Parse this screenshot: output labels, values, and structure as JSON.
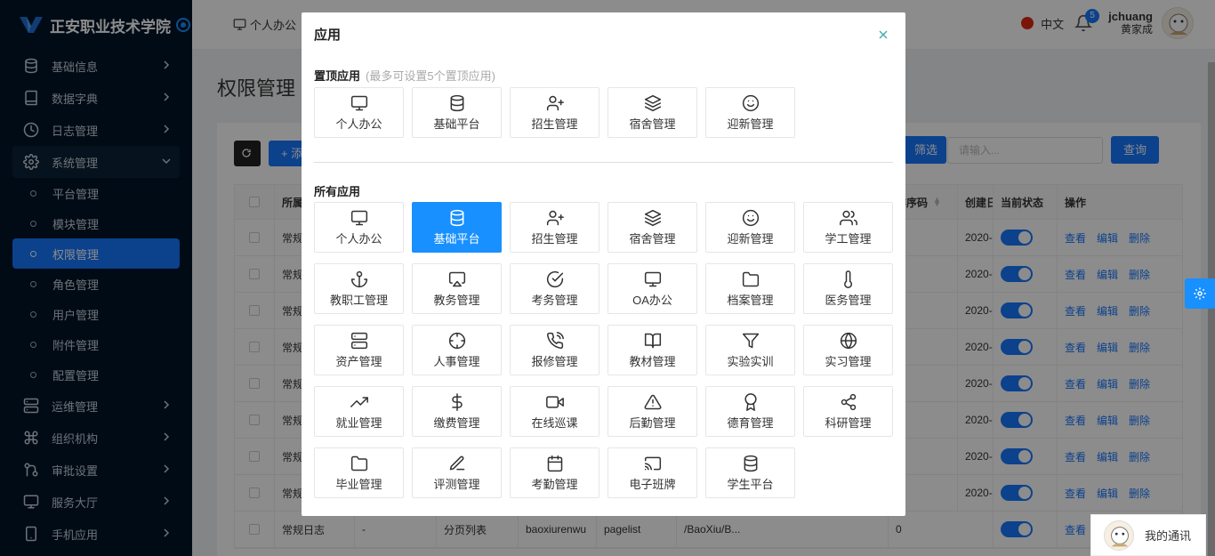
{
  "app": {
    "title": "正安职业技术学院"
  },
  "sidebar": {
    "items": [
      {
        "label": "基础信息",
        "icon": "database-icon"
      },
      {
        "label": "数据字典",
        "icon": "book-icon"
      },
      {
        "label": "日志管理",
        "icon": "clock-icon"
      },
      {
        "label": "系统管理",
        "icon": "gear-icon",
        "open": true
      }
    ],
    "sub_items": [
      {
        "label": "平台管理"
      },
      {
        "label": "模块管理"
      },
      {
        "label": "权限管理",
        "active": true
      },
      {
        "label": "角色管理"
      },
      {
        "label": "用户管理"
      },
      {
        "label": "附件管理"
      },
      {
        "label": "配置管理"
      }
    ],
    "items_after": [
      {
        "label": "运维管理",
        "icon": "server-icon"
      },
      {
        "label": "组织机构",
        "icon": "command-icon"
      },
      {
        "label": "审批设置",
        "icon": "approval-icon"
      },
      {
        "label": "服务大厅",
        "icon": "monitor-icon"
      },
      {
        "label": "手机应用",
        "icon": "mobile-icon"
      }
    ]
  },
  "header": {
    "tab_label": "个人办公",
    "lang": "中文",
    "notifications": "5",
    "username": "jchuang",
    "display_name": "黄家成"
  },
  "page": {
    "title": "权限管理",
    "add_label": "+ 添",
    "filter_label": "筛选",
    "search_placeholder": "请输入...",
    "query_label": "查询",
    "columns": {
      "c1": "所属",
      "c2": "排序码",
      "c3": "创建日",
      "c4": "当前状态",
      "c5": "操作"
    },
    "rows": [
      {
        "c1": "常规",
        "date": "2020-"
      },
      {
        "c1": "常规",
        "date": "2020-"
      },
      {
        "c1": "常规",
        "date": "2020-"
      },
      {
        "c1": "常规",
        "date": "2020-"
      },
      {
        "c1": "常规",
        "date": "2020-"
      },
      {
        "c1": "常规",
        "date": "2020-"
      },
      {
        "c1": "常规",
        "date": "2020-"
      },
      {
        "c1": "常规",
        "date": "2020-"
      }
    ],
    "last_row": {
      "c1": "常规日志",
      "c2": "-",
      "c3": "分页列表",
      "c4": "baoxiurenwu",
      "c5": "pagelist",
      "c6": "/BaoXiu/B...",
      "c7": "0",
      "date": ""
    },
    "ops": {
      "view": "查看",
      "edit": "编辑",
      "delete": "删除"
    }
  },
  "modal": {
    "title": "应用",
    "pinned_title": "置顶应用",
    "pinned_hint": "(最多可设置5个置顶应用)",
    "all_title": "所有应用",
    "pinned": [
      {
        "label": "个人办公",
        "icon": "monitor-icon"
      },
      {
        "label": "基础平台",
        "icon": "database-icon"
      },
      {
        "label": "招生管理",
        "icon": "user-plus-icon"
      },
      {
        "label": "宿舍管理",
        "icon": "layers-icon"
      },
      {
        "label": "迎新管理",
        "icon": "smile-icon"
      }
    ],
    "apps": [
      {
        "label": "个人办公",
        "icon": "monitor-icon"
      },
      {
        "label": "基础平台",
        "icon": "database-icon",
        "active": true
      },
      {
        "label": "招生管理",
        "icon": "user-plus-icon"
      },
      {
        "label": "宿舍管理",
        "icon": "layers-icon"
      },
      {
        "label": "迎新管理",
        "icon": "smile-icon"
      },
      {
        "label": "学工管理",
        "icon": "users-icon"
      },
      {
        "label": "教职工管理",
        "icon": "anchor-icon"
      },
      {
        "label": "教务管理",
        "icon": "airplay-icon"
      },
      {
        "label": "考务管理",
        "icon": "check-circle-icon"
      },
      {
        "label": "OA办公",
        "icon": "monitor-icon"
      },
      {
        "label": "档案管理",
        "icon": "folder-icon"
      },
      {
        "label": "医务管理",
        "icon": "thermometer-icon"
      },
      {
        "label": "资产管理",
        "icon": "server-icon"
      },
      {
        "label": "人事管理",
        "icon": "crosshair-icon"
      },
      {
        "label": "报修管理",
        "icon": "phone-call-icon"
      },
      {
        "label": "教材管理",
        "icon": "book-open-icon"
      },
      {
        "label": "实验实训",
        "icon": "filter-icon"
      },
      {
        "label": "实习管理",
        "icon": "globe-icon"
      },
      {
        "label": "就业管理",
        "icon": "trending-up-icon"
      },
      {
        "label": "缴费管理",
        "icon": "dollar-icon"
      },
      {
        "label": "在线巡课",
        "icon": "video-icon"
      },
      {
        "label": "后勤管理",
        "icon": "alert-triangle-icon"
      },
      {
        "label": "德育管理",
        "icon": "award-icon"
      },
      {
        "label": "科研管理",
        "icon": "share-icon"
      },
      {
        "label": "毕业管理",
        "icon": "folder-icon"
      },
      {
        "label": "评测管理",
        "icon": "pen-icon"
      },
      {
        "label": "考勤管理",
        "icon": "calendar-icon"
      },
      {
        "label": "电子班牌",
        "icon": "cast-icon"
      },
      {
        "label": "学生平台",
        "icon": "database-icon"
      }
    ]
  },
  "chat": {
    "label": "我的通讯"
  },
  "colors": {
    "primary": "#1677ff",
    "sidebar": "#001529"
  }
}
